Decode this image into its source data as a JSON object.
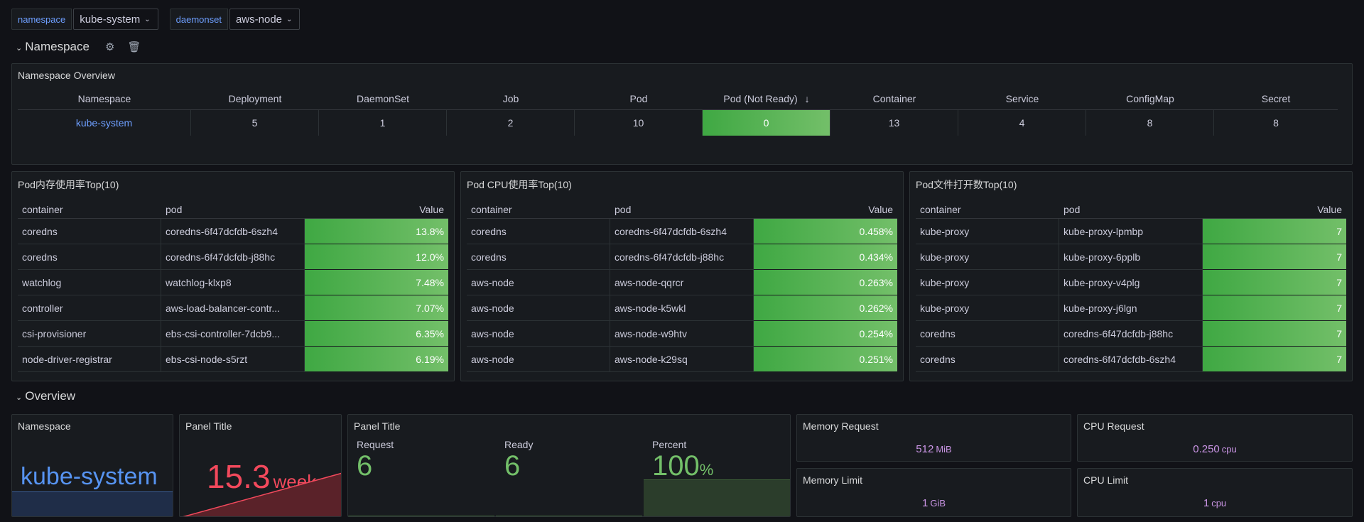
{
  "variables": [
    {
      "label": "namespace",
      "value": "kube-system"
    },
    {
      "label": "daemonset",
      "value": "aws-node"
    }
  ],
  "rows": {
    "namespace": "Namespace",
    "overview": "Overview"
  },
  "namespace_overview": {
    "title": "Namespace Overview",
    "columns": [
      "Namespace",
      "Deployment",
      "DaemonSet",
      "Job",
      "Pod",
      "Pod (Not Ready)",
      "Container",
      "Service",
      "ConfigMap",
      "Secret"
    ],
    "sort_indicator": "↓",
    "row": [
      "kube-system",
      "5",
      "1",
      "2",
      "10",
      "0",
      "13",
      "4",
      "8",
      "8"
    ]
  },
  "mem_top": {
    "title": "Pod内存使用率Top(10)",
    "columns": [
      "container",
      "pod",
      "Value"
    ],
    "rows": [
      [
        "coredns",
        "coredns-6f47dcfdb-6szh4",
        "13.8%"
      ],
      [
        "coredns",
        "coredns-6f47dcfdb-j88hc",
        "12.0%"
      ],
      [
        "watchlog",
        "watchlog-klxp8",
        "7.48%"
      ],
      [
        "controller",
        "aws-load-balancer-contr...",
        "7.07%"
      ],
      [
        "csi-provisioner",
        "ebs-csi-controller-7dcb9...",
        "6.35%"
      ],
      [
        "node-driver-registrar",
        "ebs-csi-node-s5rzt",
        "6.19%"
      ]
    ]
  },
  "cpu_top": {
    "title": "Pod CPU使用率Top(10)",
    "columns": [
      "container",
      "pod",
      "Value"
    ],
    "rows": [
      [
        "coredns",
        "coredns-6f47dcfdb-6szh4",
        "0.458%"
      ],
      [
        "coredns",
        "coredns-6f47dcfdb-j88hc",
        "0.434%"
      ],
      [
        "aws-node",
        "aws-node-qqrcr",
        "0.263%"
      ],
      [
        "aws-node",
        "aws-node-k5wkl",
        "0.262%"
      ],
      [
        "aws-node",
        "aws-node-w9htv",
        "0.254%"
      ],
      [
        "aws-node",
        "aws-node-k29sq",
        "0.251%"
      ]
    ]
  },
  "file_top": {
    "title": "Pod文件打开数Top(10)",
    "columns": [
      "container",
      "pod",
      "Value"
    ],
    "rows": [
      [
        "kube-proxy",
        "kube-proxy-lpmbp",
        "7"
      ],
      [
        "kube-proxy",
        "kube-proxy-6pplb",
        "7"
      ],
      [
        "kube-proxy",
        "kube-proxy-v4plg",
        "7"
      ],
      [
        "kube-proxy",
        "kube-proxy-j6lgn",
        "7"
      ],
      [
        "coredns",
        "coredns-6f47dcfdb-j88hc",
        "7"
      ],
      [
        "coredns",
        "coredns-6f47dcfdb-6szh4",
        "7"
      ]
    ]
  },
  "overview": {
    "namespace_panel": {
      "title": "Namespace",
      "value": "kube-system"
    },
    "age_panel": {
      "title": "Panel Title",
      "value": "15.3",
      "unit": "week"
    },
    "pods_panel": {
      "title": "Panel Title",
      "request_label": "Request",
      "request_value": "6",
      "ready_label": "Ready",
      "ready_value": "6",
      "percent_label": "Percent",
      "percent_value": "100",
      "percent_unit": "%"
    },
    "memory_request": {
      "title": "Memory Request",
      "value": "512",
      "unit": "MiB"
    },
    "cpu_request": {
      "title": "CPU Request",
      "value": "0.250",
      "unit": "cpu"
    },
    "memory_limit": {
      "title": "Memory Limit",
      "value": "1",
      "unit": "GiB"
    },
    "cpu_limit": {
      "title": "CPU Limit",
      "value": "1",
      "unit": "cpu"
    }
  },
  "colors": {
    "accent_blue": "#6e9fff",
    "green": "#73bf69",
    "red": "#f2495c",
    "purple": "#ca95e5"
  },
  "icons": [
    "chevron-down-icon",
    "gear-icon",
    "trash-icon",
    "arrow-down-icon"
  ]
}
